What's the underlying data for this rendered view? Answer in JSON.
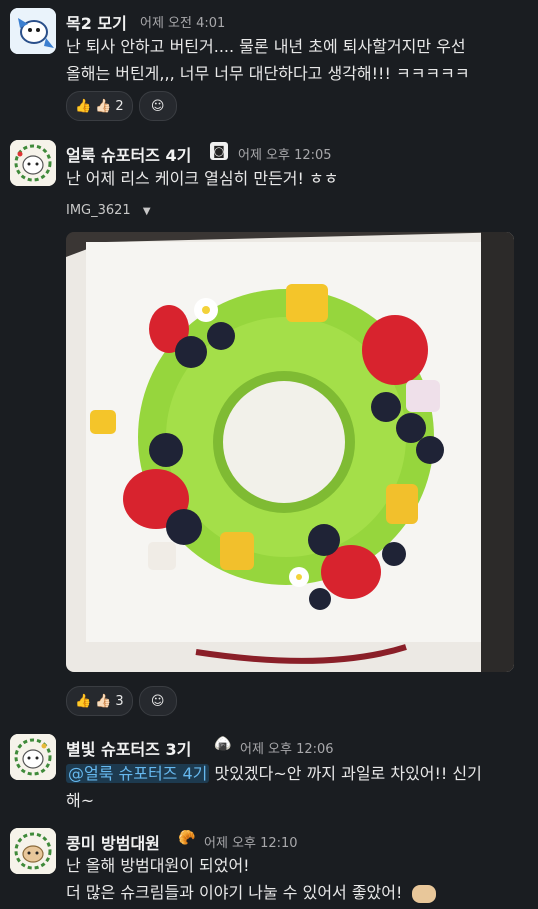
{
  "messages": [
    {
      "author": "목2 모기",
      "time": "어제 오전 4:01",
      "lines": [
        "난 퇴사 안하고 버틴거.... 물론 내년 초에 퇴사할거지만 우선",
        "올해는 버틴게,,, 너무 너무 대단하다고 생각해!!! ㅋㅋㅋㅋㅋ"
      ],
      "reactions": [
        {
          "emoji": "👍",
          "count": ""
        },
        {
          "emoji": "👍🏻",
          "count": "2"
        }
      ]
    },
    {
      "author": "얼룩 슈포터즈 4기",
      "time": "어제 오후 12:05",
      "lines": [
        "난 어제 리스 케이크 열심히 만든거! ㅎㅎ"
      ],
      "file_name": "IMG_3621",
      "reactions": [
        {
          "emoji": "👍",
          "count": ""
        },
        {
          "emoji": "👍🏻",
          "count": "3"
        }
      ]
    },
    {
      "author": "별빛 슈포터즈 3기",
      "time": "어제 오후 12:06",
      "mention": "@얼룩 슈포터즈 4기",
      "line1_rest": " 맛있겠다~안 까지 과일로 차있어!! 신기",
      "line2": "해~"
    },
    {
      "author": "콩미 방범대원",
      "time": "어제 오후 12:10",
      "lines": [
        "난 올해 방범대원이 되었어!",
        "더 많은 슈크림들과 이야기 나눌 수 있어서 좋았어!"
      ]
    }
  ]
}
